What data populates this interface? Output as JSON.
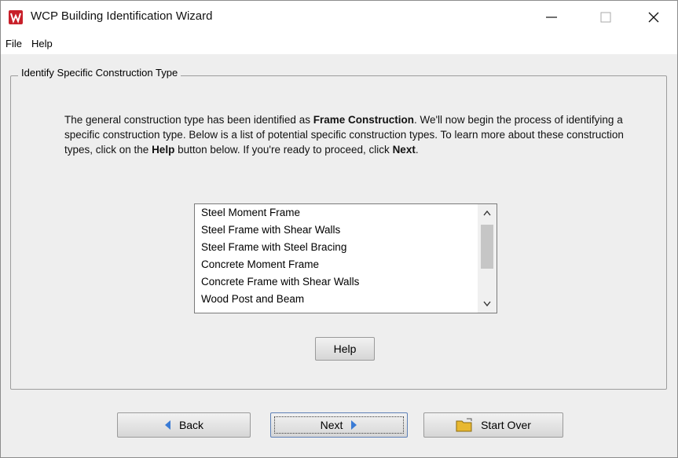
{
  "window": {
    "title": "WCP Building Identification Wizard",
    "icon": "wcp-logo-icon"
  },
  "menu": {
    "file": "File",
    "help": "Help"
  },
  "group": {
    "title": "Identify Specific Construction Type"
  },
  "description": {
    "part1": "The general construction type has been identified as ",
    "bold1": "Frame Construction",
    "part2": ". We'll now begin the process of identifying a specific construction type. Below is a list of potential specific construction types. To learn more about these construction types, click on the ",
    "bold2": "Help",
    "part3": " button below. If you're ready to proceed, click ",
    "bold3": "Next",
    "part4": "."
  },
  "construction_types": [
    "Steel Moment Frame",
    "Steel Frame with Shear Walls",
    "Steel Frame with Steel Bracing",
    "Concrete Moment Frame",
    "Concrete Frame with Shear Walls",
    "Wood Post and Beam"
  ],
  "buttons": {
    "help": "Help",
    "back": "Back",
    "next": "Next",
    "start_over": "Start Over"
  },
  "colors": {
    "accent_arrow": "#3a7bd5",
    "logo": "#c8202a",
    "folder": "#e8b830"
  }
}
